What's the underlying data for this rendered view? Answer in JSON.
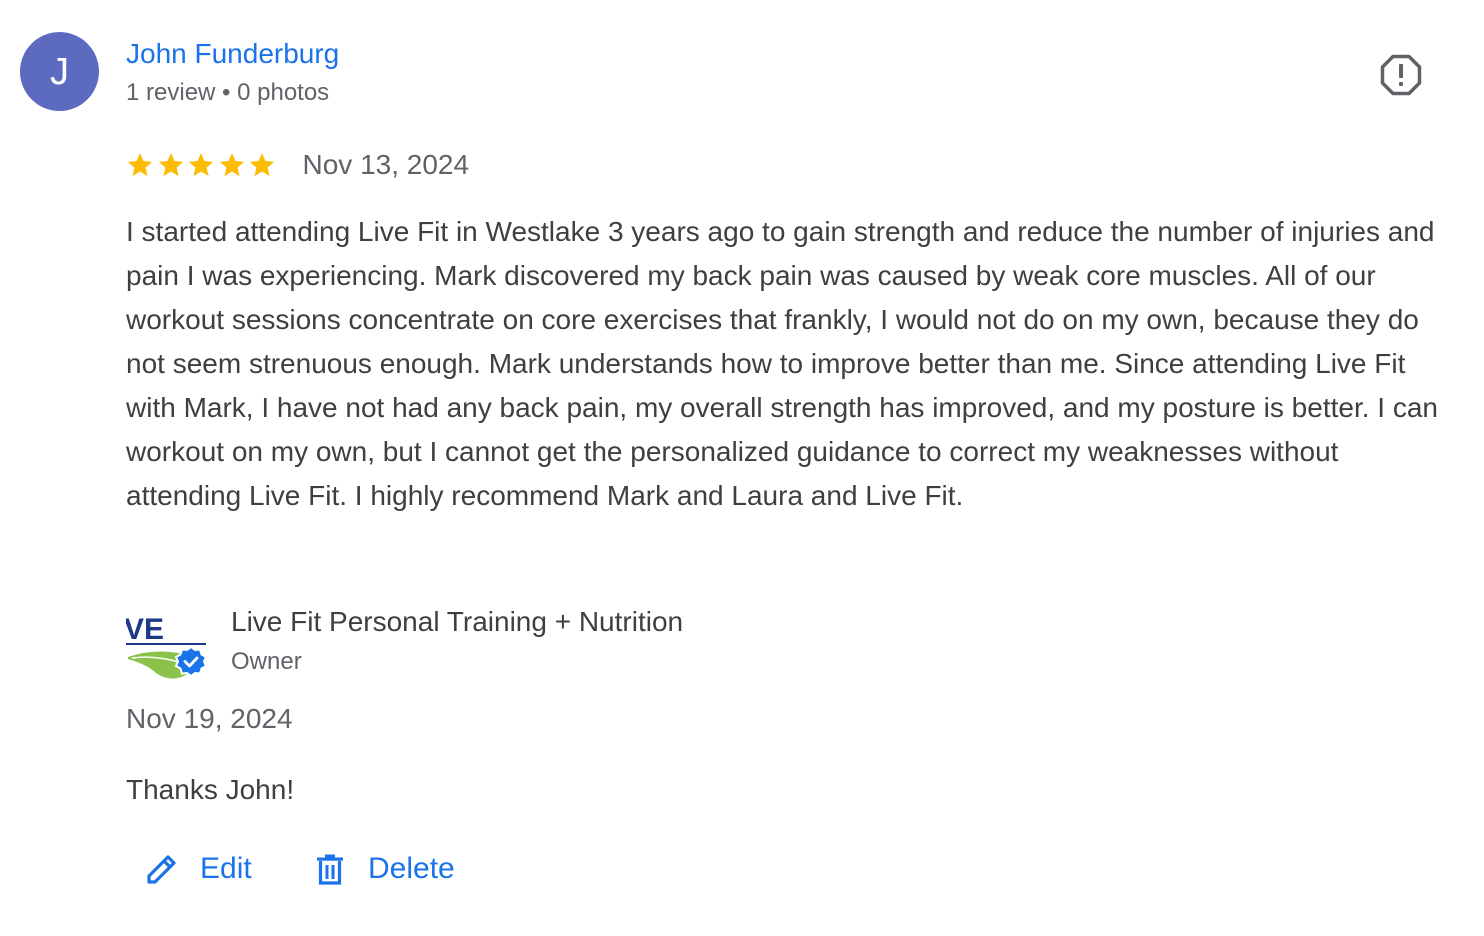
{
  "reviewer": {
    "initial": "J",
    "name": "John Funderburg",
    "meta": "1 review • 0 photos",
    "avatar_color": "#5c6bc0"
  },
  "review": {
    "rating": 5,
    "max_rating": 5,
    "date": "Nov 13, 2024",
    "text": "I started attending Live Fit in Westlake 3 years ago to gain strength and reduce the number of injuries and pain I was experiencing. Mark discovered my back pain was caused by weak core muscles. All of our workout sessions concentrate on core exercises that frankly, I would not do on my own, because they do not seem strenuous enough. Mark understands how to improve better than me. Since attending Live Fit with Mark, I have not had any back pain, my overall strength has improved, and my posture is better. I can workout on my own, but I cannot get the personalized guidance to correct my weaknesses without attending Live Fit. I highly recommend Mark and Laura and Live Fit.",
    "star_color": "#fbbc04",
    "report_icon": "report-icon"
  },
  "owner_reply": {
    "logo_text": "VE",
    "owner_name": "Live Fit Personal Training + Nutrition",
    "owner_role": "Owner",
    "verified_icon": "verified-badge-icon",
    "date": "Nov 19, 2024",
    "text": "Thanks John!"
  },
  "actions": {
    "edit_label": "Edit",
    "delete_label": "Delete",
    "edit_icon": "pencil-icon",
    "delete_icon": "trash-icon"
  },
  "colors": {
    "link_blue": "#1a73e8",
    "text_primary": "#3c4043",
    "text_secondary": "#5f6368"
  }
}
